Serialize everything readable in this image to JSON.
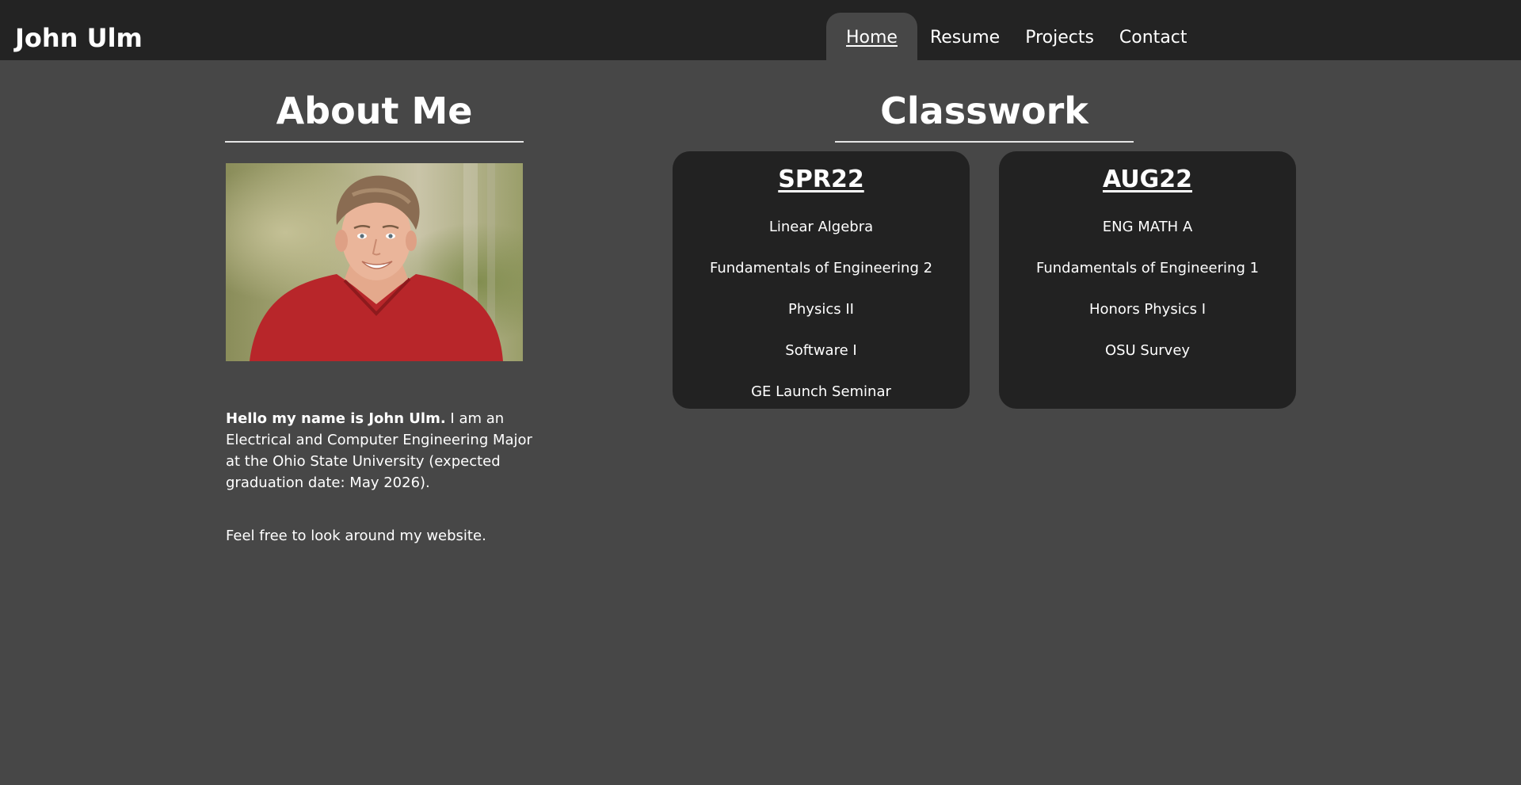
{
  "header": {
    "site_title": "John Ulm",
    "nav": [
      {
        "label": "Home",
        "active": true
      },
      {
        "label": "Resume",
        "active": false
      },
      {
        "label": "Projects",
        "active": false
      },
      {
        "label": "Contact",
        "active": false
      }
    ]
  },
  "about": {
    "title": "About Me",
    "intro_bold": "Hello my name is John Ulm.",
    "intro_rest": " I am an Electrical and Computer Engineering Major at the Ohio State University (expected graduation date: May 2026).",
    "closing": "Feel free to look around my website."
  },
  "classwork": {
    "title": "Classwork",
    "terms": [
      {
        "name": "SPR22",
        "courses": [
          "Linear Algebra",
          "Fundamentals of Engineering 2",
          "Physics II",
          "Software I",
          "GE Launch Seminar"
        ]
      },
      {
        "name": "AUG22",
        "courses": [
          "ENG MATH A",
          "Fundamentals of Engineering 1",
          "Honors Physics I",
          "OSU Survey"
        ]
      }
    ]
  },
  "colors": {
    "page_background": "#474747",
    "header_background": "#232323",
    "card_background": "#222222",
    "text": "#ffffff",
    "shirt": "#b8262a"
  }
}
